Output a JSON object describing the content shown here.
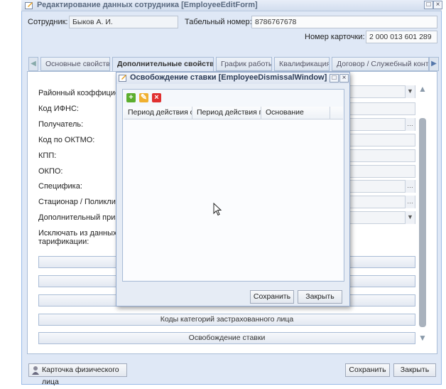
{
  "main_window": {
    "title": "Редактирование данных сотрудника [EmployeeEditForm]"
  },
  "employee": {
    "label": "Сотрудник:",
    "value": "Быков А. И.",
    "tab_number_label": "Табельный номер:",
    "tab_number_value": "8786767678",
    "card_number_label": "Номер карточки:",
    "card_number_value": "2 000 013 601 289"
  },
  "tabs": [
    {
      "label": "Основные свойства"
    },
    {
      "label": "Дополнительные свойства"
    },
    {
      "label": "График работы"
    },
    {
      "label": "Квалификация"
    },
    {
      "label": "Договор / Служебный контракт"
    }
  ],
  "form_labels": {
    "district_coef": "Районный коэффициент",
    "ifns_code": "Код ИФНС:",
    "recipient": "Получатель:",
    "oktmo": "Код по ОКТМО:",
    "kpp": "КПП:",
    "okpo": "ОКПО:",
    "specifics": "Специфика:",
    "hospital": "Стационар / Поликлини",
    "extra_sign": "Дополнительный призн",
    "exclude_line1": "Исключать из данных п",
    "exclude_line2": "тарификации:"
  },
  "buttons": {
    "insured_category_codes": "Коды категорий застрахованного лица",
    "dismissal": "Освобождение ставки",
    "person_card": "Карточка физического лица",
    "save": "Сохранить",
    "close": "Закрыть"
  },
  "dialog": {
    "title": "Освобождение ставки [EmployeeDismissalWindow]",
    "columns": [
      "Период действия с",
      "Период действия по",
      "Основание"
    ],
    "save": "Сохранить",
    "close": "Закрыть"
  },
  "colors": {
    "window_bg": "#dfe8f6",
    "border": "#99bbe8",
    "add_icon": "#5cae2e",
    "edit_icon": "#f0b030",
    "delete_icon": "#e03030"
  }
}
